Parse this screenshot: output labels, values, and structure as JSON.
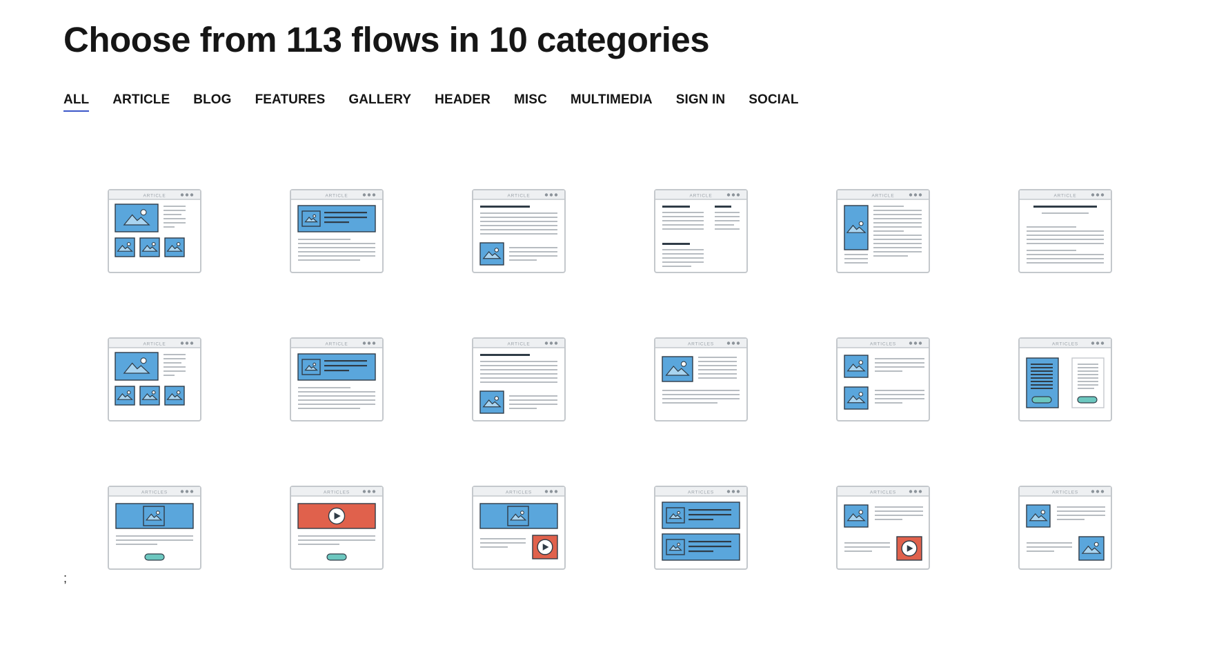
{
  "page": {
    "title": "Choose from 113 flows in 10 categories",
    "stray_text": ";"
  },
  "tabs": [
    {
      "label": "ALL",
      "active": true
    },
    {
      "label": "ARTICLE",
      "active": false
    },
    {
      "label": "BLOG",
      "active": false
    },
    {
      "label": "FEATURES",
      "active": false
    },
    {
      "label": "GALLERY",
      "active": false
    },
    {
      "label": "HEADER",
      "active": false
    },
    {
      "label": "MISC",
      "active": false
    },
    {
      "label": "MULTIMEDIA",
      "active": false
    },
    {
      "label": "SIGN IN",
      "active": false
    },
    {
      "label": "SOCIAL",
      "active": false
    }
  ],
  "colors": {
    "accent_underline": "#3a56c8",
    "image_blue": "#5aa6dc",
    "video_red": "#e0614c",
    "button_teal": "#6cc7bf",
    "frame_gray": "#c4c8cc",
    "line_gray": "#b7bcc1",
    "ink_dark": "#2f3b46"
  },
  "cards": [
    {
      "label": "ARTICLE",
      "layout": "gallery-hero"
    },
    {
      "label": "ARTICLE",
      "layout": "header-banner"
    },
    {
      "label": "ARTICLE",
      "layout": "text-image-bottom"
    },
    {
      "label": "ARTICLE",
      "layout": "two-column-text"
    },
    {
      "label": "ARTICLE",
      "layout": "tall-image-left"
    },
    {
      "label": "ARTICLE",
      "layout": "centered-text"
    },
    {
      "label": "ARTICLE",
      "layout": "gallery-hero"
    },
    {
      "label": "ARTICLE",
      "layout": "header-banner"
    },
    {
      "label": "ARTICLE",
      "layout": "text-image-bottom"
    },
    {
      "label": "ARTICLES",
      "layout": "image-left-text"
    },
    {
      "label": "ARTICLES",
      "layout": "two-row-list"
    },
    {
      "label": "ARTICLES",
      "layout": "two-panels-button"
    },
    {
      "label": "ARTICLES",
      "layout": "banner-button"
    },
    {
      "label": "ARTICLES",
      "layout": "video-banner-button"
    },
    {
      "label": "ARTICLES",
      "layout": "banner-video-corner"
    },
    {
      "label": "ARTICLES",
      "layout": "two-banners"
    },
    {
      "label": "ARTICLES",
      "layout": "image-text-video"
    },
    {
      "label": "ARTICLES",
      "layout": "image-text-image"
    }
  ]
}
